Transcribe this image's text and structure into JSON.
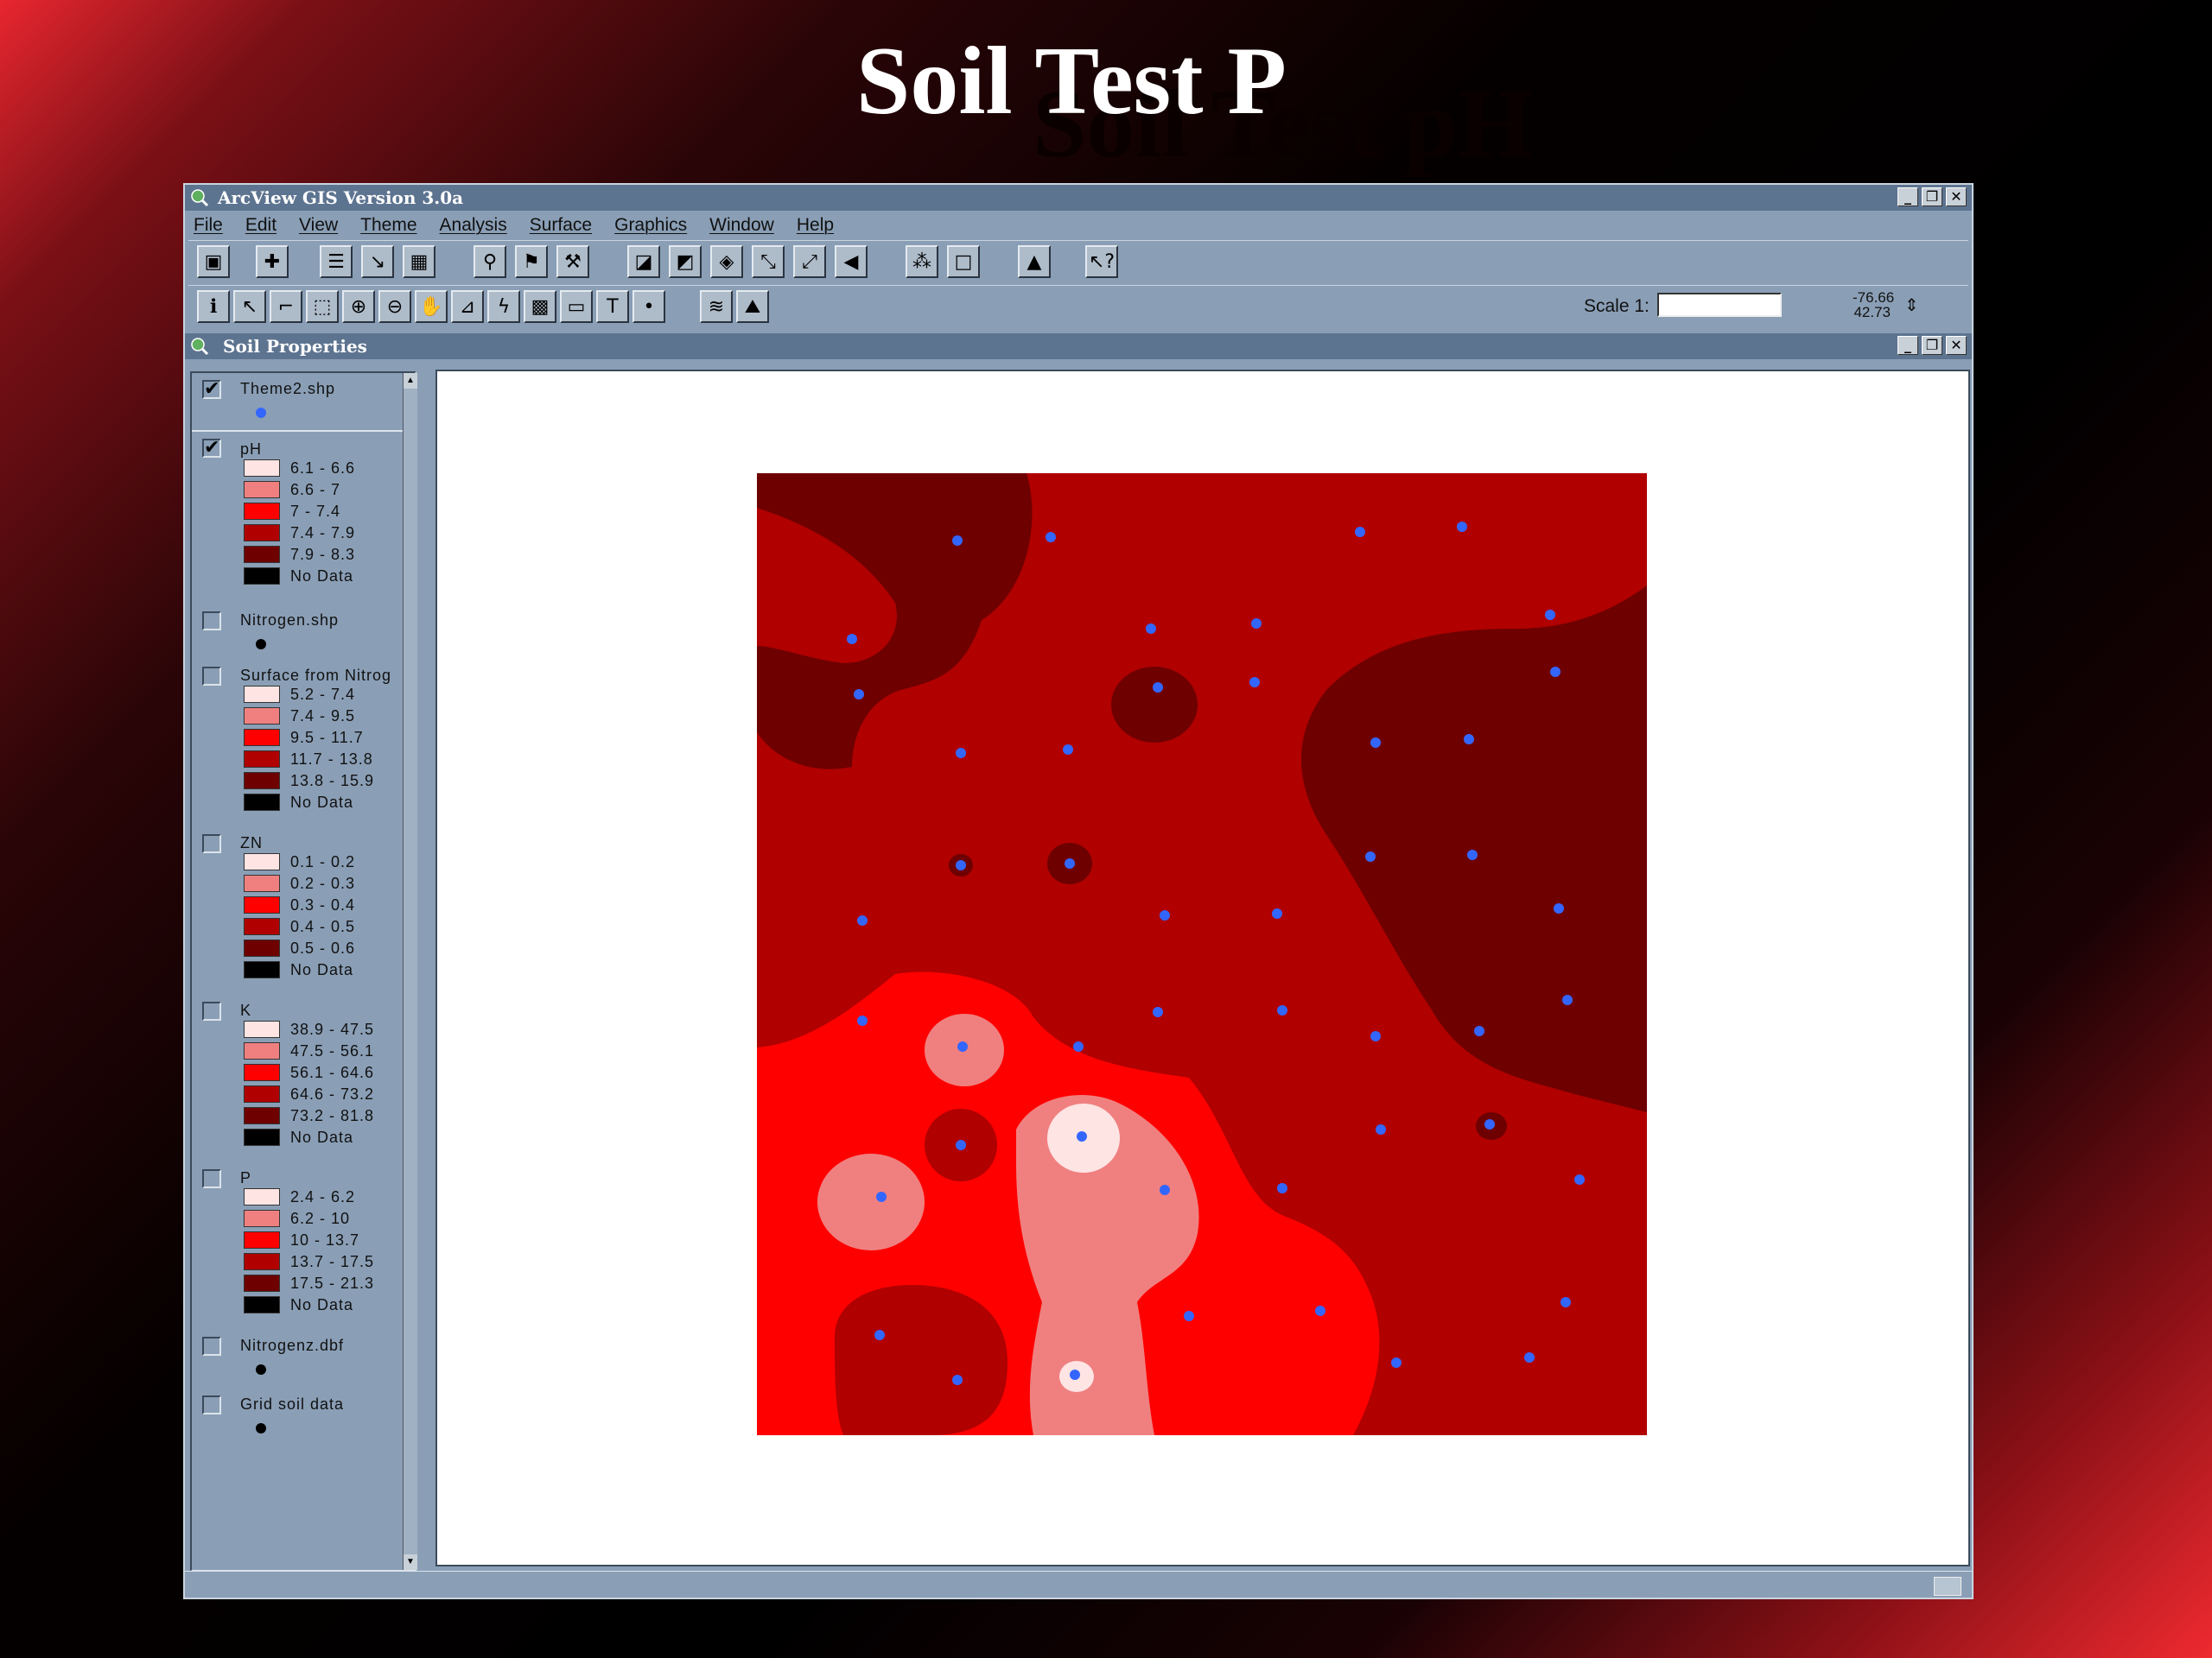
{
  "slide": {
    "title": "Soil Test P",
    "ghost_title": "Soil Test pH"
  },
  "app": {
    "title": "ArcView GIS Version 3.0a",
    "menu": [
      "File",
      "Edit",
      "View",
      "Theme",
      "Analysis",
      "Surface",
      "Graphics",
      "Window",
      "Help"
    ],
    "scale_label": "Scale 1:",
    "scale_value": "",
    "coord_x": "-76.66",
    "coord_y": "42.73"
  },
  "view": {
    "title": "Soil Properties"
  },
  "toc": {
    "themes": [
      {
        "name": "Theme2.shp",
        "checked": true,
        "type": "point",
        "symbol_color": "#3366ff"
      },
      {
        "name": "pH",
        "checked": true,
        "type": "grid",
        "legend": [
          "6.1 - 6.6",
          "6.6 - 7",
          "7 - 7.4",
          "7.4 - 7.9",
          "7.9 - 8.3",
          "No Data"
        ]
      },
      {
        "name": "Nitrogen.shp",
        "checked": false,
        "type": "point",
        "symbol_color": "#000000"
      },
      {
        "name": "Surface from Nitrog",
        "checked": false,
        "type": "grid",
        "legend": [
          "5.2 - 7.4",
          "7.4 - 9.5",
          "9.5 - 11.7",
          "11.7 - 13.8",
          "13.8 - 15.9",
          "No Data"
        ]
      },
      {
        "name": "ZN",
        "checked": false,
        "type": "grid",
        "legend": [
          "0.1 - 0.2",
          "0.2 - 0.3",
          "0.3 - 0.4",
          "0.4 - 0.5",
          "0.5 - 0.6",
          "No Data"
        ]
      },
      {
        "name": "K",
        "checked": false,
        "type": "grid",
        "legend": [
          "38.9 - 47.5",
          "47.5 - 56.1",
          "56.1 - 64.6",
          "64.6 - 73.2",
          "73.2 - 81.8",
          "No Data"
        ]
      },
      {
        "name": "P",
        "checked": false,
        "type": "grid",
        "legend": [
          "2.4 - 6.2",
          "6.2 - 10",
          "10 - 13.7",
          "13.7 - 17.5",
          "17.5 - 21.3",
          "No Data"
        ]
      },
      {
        "name": "Nitrogenz.dbf",
        "checked": false,
        "type": "point",
        "symbol_color": "#000000"
      },
      {
        "name": "Grid soil data",
        "checked": false,
        "type": "point",
        "symbol_color": "#000000"
      }
    ],
    "ramp_colors": [
      "#ffe4e4",
      "#f08080",
      "#ff0000",
      "#b00000",
      "#6e0000",
      "#000000"
    ]
  },
  "toolbar1_icons": [
    "save-icon",
    "add-theme-icon",
    "theme-properties-icon",
    "edit-legend-icon",
    "open-table-icon",
    "find-icon",
    "locate-address-icon",
    "query-builder-icon",
    "zoom-full-extent-icon",
    "zoom-active-themes-icon",
    "zoom-selected-icon",
    "zoom-in-fixed-icon",
    "zoom-out-fixed-icon",
    "zoom-previous-icon",
    "select-by-theme-icon",
    "clear-selection-icon",
    "histogram-icon",
    "help-icon"
  ],
  "toolbar2_icons": [
    "identify-icon",
    "pointer-icon",
    "vertex-edit-icon",
    "select-feature-icon",
    "zoom-in-icon",
    "zoom-out-icon",
    "pan-icon",
    "measure-icon",
    "hot-link-icon",
    "area-of-interest-icon",
    "label-icon",
    "text-icon",
    "draw-point-icon",
    "contour-icon",
    "profile-icon"
  ]
}
